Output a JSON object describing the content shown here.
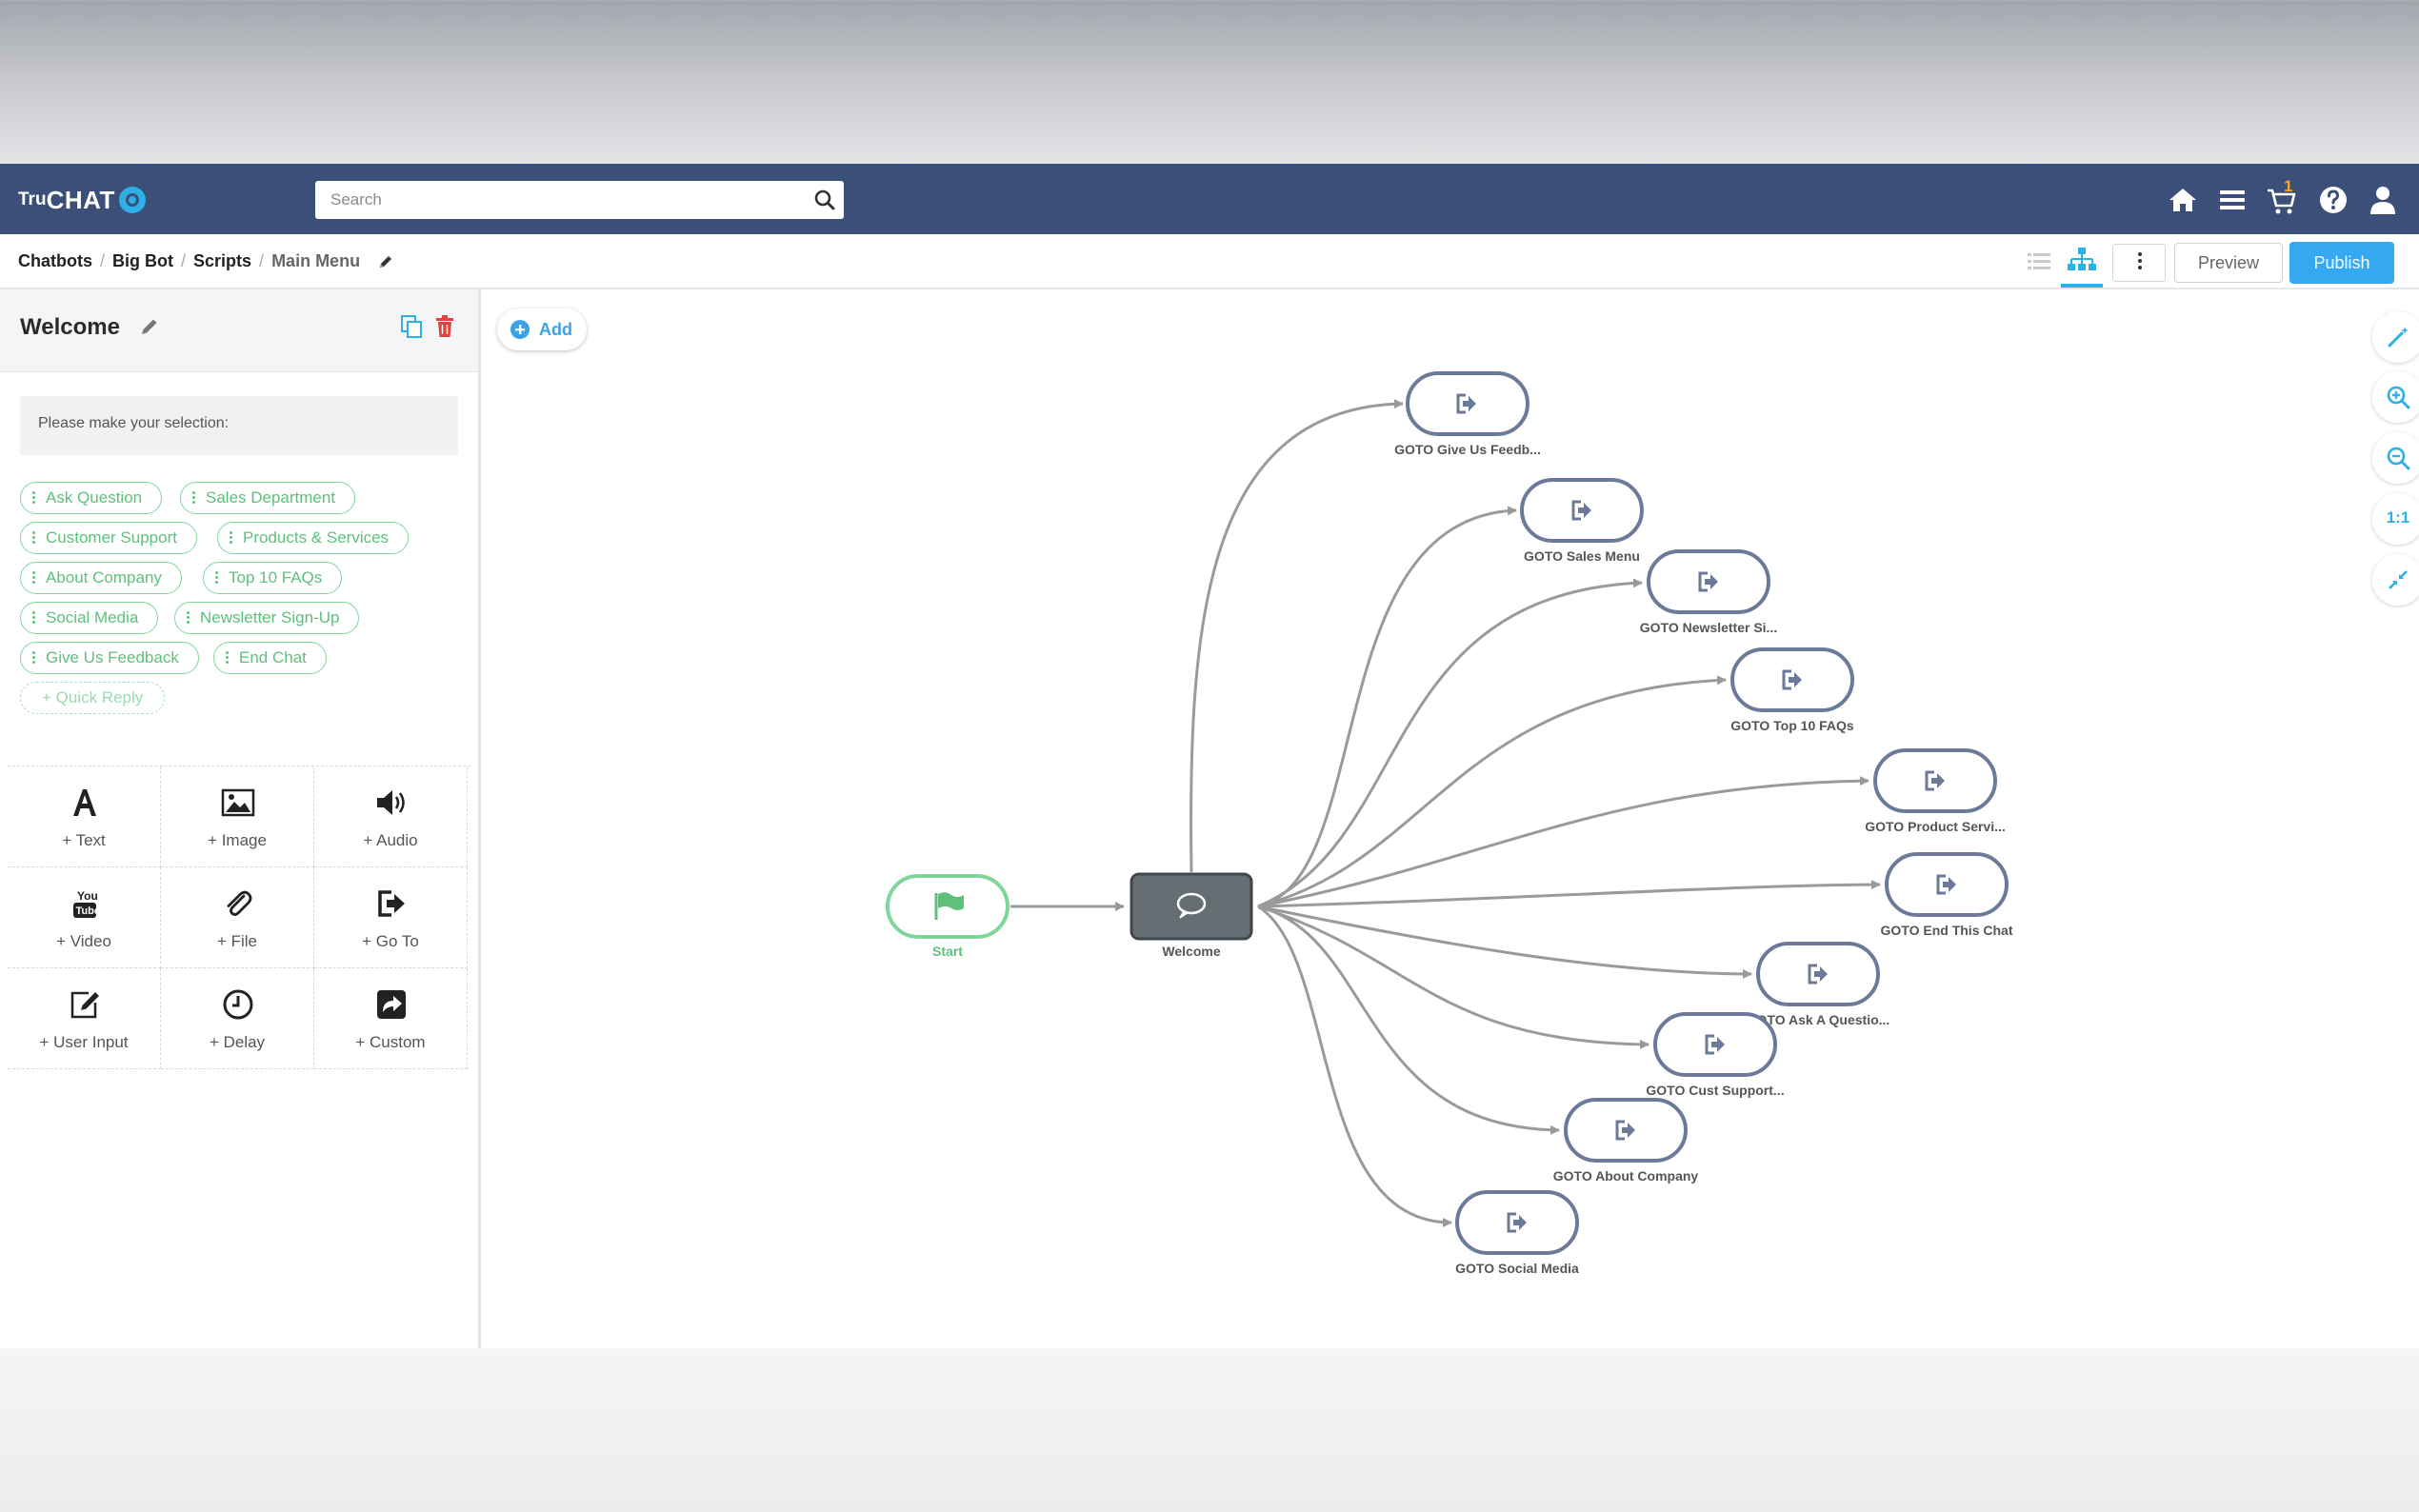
{
  "app": {
    "logo_prefix": "Tru",
    "logo_main": "CHAT",
    "search_placeholder": "Search",
    "cart_count": "1"
  },
  "breadcrumb": [
    "Chatbots",
    "Big Bot",
    "Scripts",
    "Main Menu"
  ],
  "toolbar": {
    "preview_label": "Preview",
    "publish_label": "Publish"
  },
  "panel": {
    "title": "Welcome",
    "message": "Please make your selection:",
    "quick_replies": [
      [
        "Ask Question",
        "Sales Department"
      ],
      [
        "Customer Support",
        "Products & Services"
      ],
      [
        "About Company",
        "Top 10 FAQs"
      ],
      [
        "Social Media",
        "Newsletter Sign-Up"
      ],
      [
        "Give Us Feedback",
        "End Chat"
      ]
    ],
    "add_quick_reply": "+ Quick Reply",
    "tools": [
      "+ Text",
      "+ Image",
      "+ Audio",
      "+ Video",
      "+ File",
      "+ Go To",
      "+ User Input",
      "+ Delay",
      "+ Custom"
    ]
  },
  "canvas": {
    "add_label": "Add",
    "zoom_ratio_label": "1:1",
    "start_label": "Start",
    "welcome_label": "Welcome",
    "goto_nodes": [
      "GOTO Give Us Feedb...",
      "GOTO Sales Menu",
      "GOTO Newsletter Si...",
      "GOTO Top 10 FAQs",
      "GOTO Product Servi...",
      "GOTO End This Chat",
      "GOTO Ask A Questio...",
      "GOTO Cust Support...",
      "GOTO About Company",
      "GOTO Social Media"
    ]
  },
  "colors": {
    "topbar": "#3b4f79",
    "accent": "#2cb0e6",
    "publish": "#35a8f2",
    "quick_reply": "#5fc07c",
    "node_border": "#6c7a99",
    "welcome_node": "#646e73",
    "start_node": "#7fd69a",
    "delete": "#e0413a"
  }
}
